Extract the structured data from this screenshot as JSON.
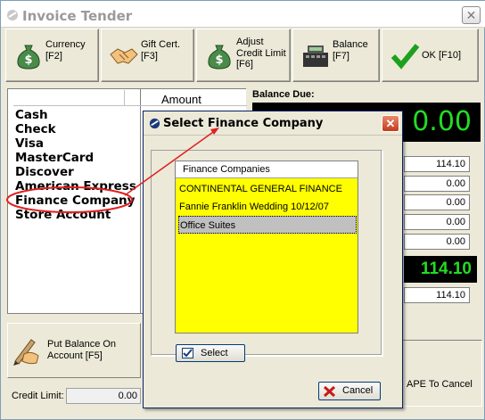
{
  "window": {
    "title": "Invoice Tender",
    "close_glyph": "✕"
  },
  "toolbar": [
    {
      "id": "currency",
      "label": "Currency\n[F2]",
      "icon": "money-bag-icon"
    },
    {
      "id": "giftcert",
      "label": "Gift Cert.\n[F3]",
      "icon": "handshake-icon"
    },
    {
      "id": "adjust",
      "label": "Adjust\nCredit Limit\n[F6]",
      "icon": "money-bag-icon"
    },
    {
      "id": "balance",
      "label": "Balance\n[F7]",
      "icon": "cash-register-icon"
    },
    {
      "id": "ok",
      "label": "OK [F10]",
      "icon": "checkmark-icon"
    }
  ],
  "tender_list": {
    "column_amount": "Amount",
    "items": [
      "Cash",
      "Check",
      "Visa",
      "MasterCard",
      "Discover",
      "American Express",
      "Finance Company",
      "Store Account"
    ]
  },
  "balance": {
    "label": "Balance Due:",
    "digital": "0.00",
    "amounts": [
      "114.10",
      "0.00",
      "0.00",
      "0.00",
      "0.00"
    ],
    "total": "114.10",
    "subtotal": "114.10"
  },
  "put_balance": {
    "label": "Put Balance On\nAccount [F5]"
  },
  "credit": {
    "label": "Credit Limit:",
    "value": "0.00"
  },
  "escape_text": "APE To Cancel",
  "dialog": {
    "title": "Select Finance Company",
    "list_header": "Finance Companies",
    "rows": [
      "CONTINENTAL GENERAL FINANCE",
      "Fannie Franklin Wedding 10/12/07",
      "Office Suites"
    ],
    "select_label": "Select",
    "cancel_label": "Cancel",
    "close_glyph": "✕"
  },
  "colors": {
    "accent_red": "#e02020",
    "digital_green": "#22dd22",
    "list_yellow": "#ffff00"
  }
}
